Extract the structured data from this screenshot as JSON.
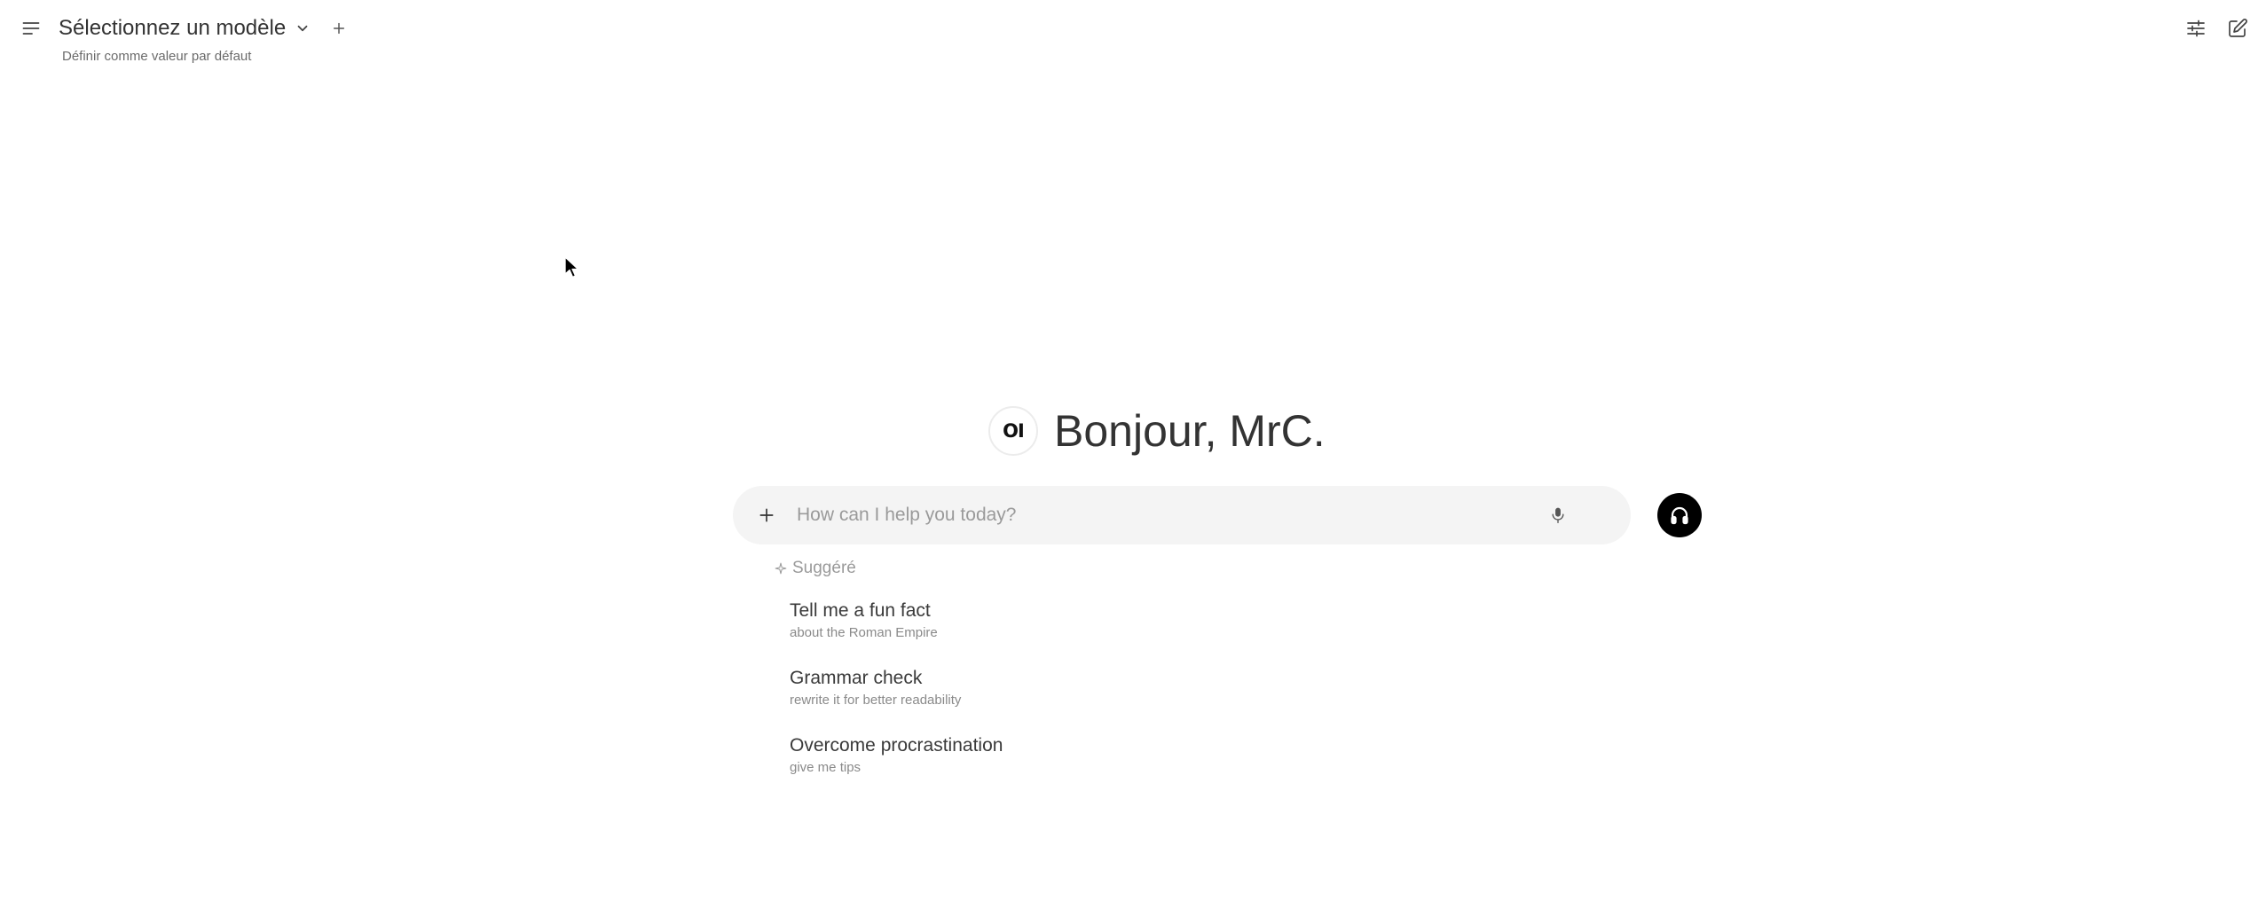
{
  "header": {
    "model_title": "Sélectionnez un modèle",
    "set_default_label": "Définir comme valeur par défaut",
    "icons": {
      "menu": "menu-icon",
      "dropdown": "chevron-down-icon",
      "add_model": "plus-icon",
      "controls": "sliders-icon",
      "new_chat": "edit-icon"
    }
  },
  "greeting": {
    "logo_text": "OI",
    "text": "Bonjour, MrC."
  },
  "input": {
    "placeholder": "How can I help you today?",
    "value": "",
    "icons": {
      "attach": "plus-icon",
      "mic": "microphone-icon",
      "voice": "headphones-icon"
    },
    "voice_button_color": "#000000"
  },
  "suggestions": {
    "header": "Suggéré",
    "items": [
      {
        "title": "Tell me a fun fact",
        "subtitle": "about the Roman Empire"
      },
      {
        "title": "Grammar check",
        "subtitle": "rewrite it for better readability"
      },
      {
        "title": "Overcome procrastination",
        "subtitle": "give me tips"
      }
    ]
  }
}
